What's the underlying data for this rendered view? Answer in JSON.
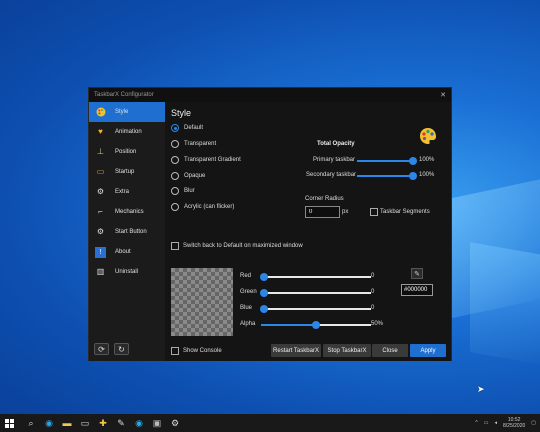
{
  "window": {
    "title": "TaskbarX Configurator",
    "close_glyph": "✕"
  },
  "sidebar": {
    "items": [
      {
        "label": "Style",
        "icon": "palette-icon",
        "glyph": "🎨"
      },
      {
        "label": "Animation",
        "icon": "heart-icon",
        "glyph": "♥"
      },
      {
        "label": "Position",
        "icon": "position-icon",
        "glyph": "⊥"
      },
      {
        "label": "Startup",
        "icon": "startup-icon",
        "glyph": "▭"
      },
      {
        "label": "Extra",
        "icon": "gear-icon",
        "glyph": "⚙"
      },
      {
        "label": "Mechanics",
        "icon": "mechanics-icon",
        "glyph": "⌐"
      },
      {
        "label": "Start Button",
        "icon": "start-gear-icon",
        "glyph": "⚙"
      },
      {
        "label": "About",
        "icon": "info-icon",
        "glyph": "!"
      },
      {
        "label": "Uninstall",
        "icon": "trash-icon",
        "glyph": "▥"
      }
    ],
    "bottom": [
      {
        "icon": "refresh-icon",
        "glyph": "⟳"
      },
      {
        "icon": "restore-icon",
        "glyph": "↻"
      }
    ]
  },
  "style": {
    "heading": "Style",
    "options": [
      "Default",
      "Transparent",
      "Transparent Gradient",
      "Opaque",
      "Blur",
      "Acrylic (can flicker)"
    ],
    "selected_index": 0
  },
  "opacity": {
    "title": "Total Opacity",
    "primary_label": "Primary taskbar",
    "primary_value": "100%",
    "primary_fraction": 1.0,
    "secondary_label": "Secondary taskbar",
    "secondary_value": "100%",
    "secondary_fraction": 1.0
  },
  "corner": {
    "label": "Corner Radius",
    "value": "0",
    "unit": "px",
    "segments_label": "Taskbar Segments"
  },
  "switch_back": {
    "label": "Switch back to Default on maximized window"
  },
  "color": {
    "red_label": "Red",
    "red_value": "0",
    "green_label": "Green",
    "green_value": "0",
    "blue_label": "Blue",
    "blue_value": "0",
    "alpha_label": "Alpha",
    "alpha_value": "50%",
    "alpha_fraction": 0.5,
    "hex": "#000000"
  },
  "footer": {
    "show_console": "Show Console",
    "restart": "Restart TaskbarX",
    "stop": "Stop TaskbarX",
    "close": "Close",
    "apply": "Apply"
  },
  "taskbar": {
    "icons": [
      "windows-icon",
      "search-icon",
      "edge-icon",
      "explorer-icon",
      "files-icon",
      "taskbarx-icon",
      "app-icon",
      "edge-icon-2",
      "terminal-icon",
      "settings-icon"
    ],
    "glyphs": [
      "⊞",
      "⌕",
      "◉",
      "▬",
      "▭",
      "✚",
      "✎",
      "◉",
      "▣",
      "⚙"
    ],
    "tray_glyph": "^",
    "time": "10:52",
    "date": "8/25/2020"
  },
  "colors": {
    "accent": "#1f6fd1",
    "window_bg": "#141414",
    "sidebar_bg": "#1b1b1b"
  }
}
